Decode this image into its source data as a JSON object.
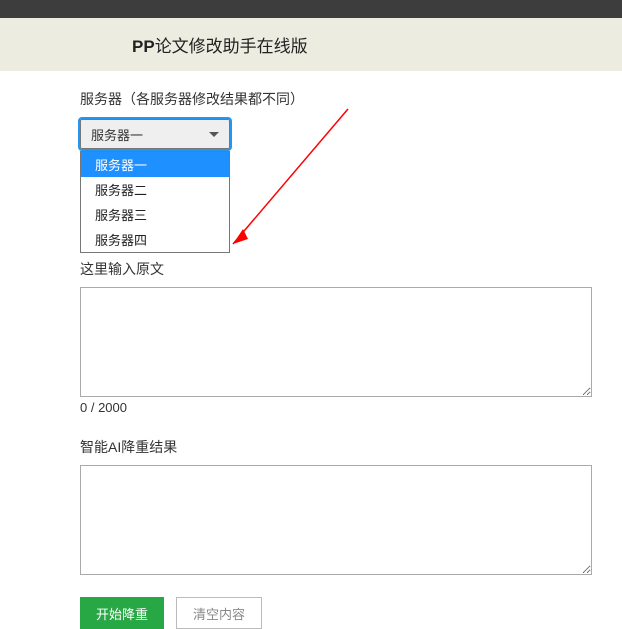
{
  "title": {
    "bold": "PP",
    "rest": "论文修改助手在线版"
  },
  "server": {
    "label": "服务器（各服务器修改结果都不同）",
    "selected": "服务器一",
    "options": [
      "服务器一",
      "服务器二",
      "服务器三",
      "服务器四"
    ]
  },
  "source": {
    "label": "这里输入原文",
    "value": "",
    "counter": "0 / 2000"
  },
  "result": {
    "label": "智能AI降重结果",
    "value": ""
  },
  "buttons": {
    "start": "开始降重",
    "clear": "清空内容"
  },
  "annotation": {
    "color": "#ff0000"
  }
}
